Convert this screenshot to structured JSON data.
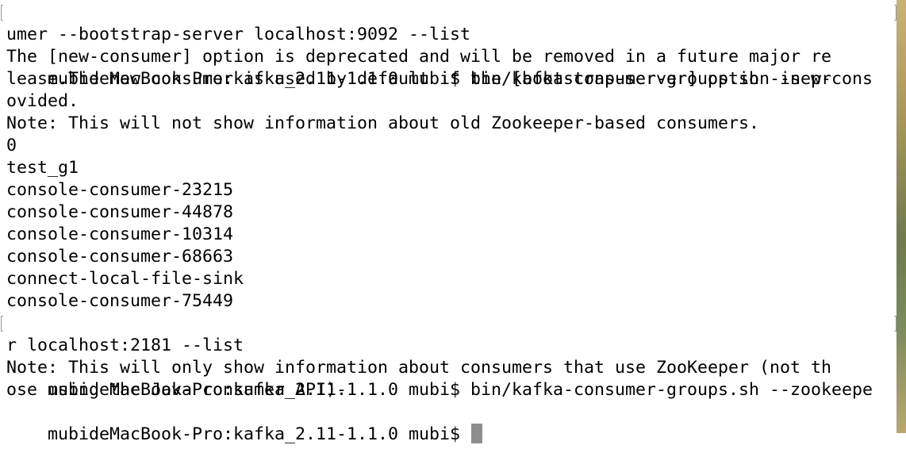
{
  "terminal": {
    "lines": [
      "mubideMacBook-Pro:kafka_2.11-1.1.0 mubi$ bin/kafka-consumer-groups.sh --new-cons",
      "umer --bootstrap-server localhost:9092 --list",
      "The [new-consumer] option is deprecated and will be removed in a future major re",
      "lease.The new consumer is used by default if the [bootstrap-server] option is pr",
      "ovided.",
      "Note: This will not show information about old Zookeeper-based consumers.",
      "0",
      "test_g1",
      "console-consumer-23215",
      "console-consumer-44878",
      "console-consumer-10314",
      "console-consumer-68663",
      "connect-local-file-sink",
      "console-consumer-75449",
      "mubideMacBook-Pro:kafka_2.11-1.1.0 mubi$ bin/kafka-consumer-groups.sh --zookeepe",
      "r localhost:2181 --list",
      "Note: This will only show information about consumers that use ZooKeeper (not th",
      "ose using the Java consumer API).",
      "mubideMacBook-Pro:kafka_2.11-1.1.0 mubi$ "
    ],
    "text_color": "#000000",
    "background_color": "#ffffff",
    "cursor_color": "#8e8e8e"
  }
}
